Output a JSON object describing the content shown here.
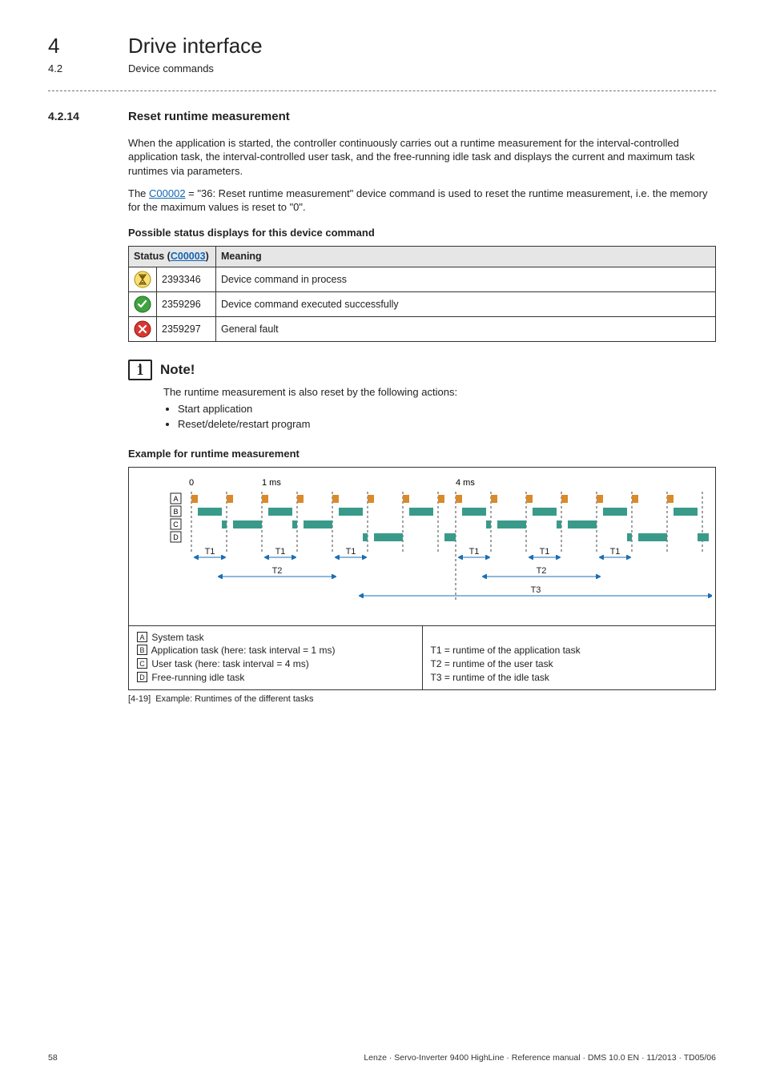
{
  "header": {
    "chapter_num": "4",
    "chapter_title": "Drive interface",
    "sub_num": "4.2",
    "sub_title": "Device commands"
  },
  "section": {
    "num": "4.2.14",
    "title": "Reset runtime measurement"
  },
  "paragraphs": {
    "p1": "When the application is started, the controller continuously carries out a runtime measurement for the interval-controlled application task, the interval-controlled user task, and the free-running idle task and displays the current and maximum task runtimes via parameters.",
    "p2a": "The ",
    "p2_link": "C00002",
    "p2b": " = \"36: Reset runtime measurement\" device command is used to reset the runtime measurement, i.e. the memory for the maximum values is reset to \"0\"."
  },
  "status_heading": "Possible status displays for this device command",
  "status_table": {
    "head_status_label": "Status (",
    "head_status_link": "C00003",
    "head_status_close": ")",
    "head_meaning": "Meaning",
    "rows": [
      {
        "num": "2393346",
        "meaning": "Device command in process"
      },
      {
        "num": "2359296",
        "meaning": "Device command executed successfully"
      },
      {
        "num": "2359297",
        "meaning": "General fault"
      }
    ]
  },
  "note": {
    "title": "Note!",
    "lead": "The runtime measurement is also reset by the following actions:",
    "bullets": [
      "Start application",
      "Reset/delete/restart program"
    ]
  },
  "example_heading": "Example for runtime measurement",
  "diagram": {
    "axis0": "0",
    "axis1ms": "1 ms",
    "axis4ms": "4 ms",
    "labelsABCD": {
      "A": "A",
      "B": "B",
      "C": "C",
      "D": "D"
    },
    "T1": "T1",
    "T2": "T2",
    "T3": "T3",
    "legend_left": {
      "A": " System task",
      "B": " Application task (here: task interval = 1 ms)",
      "C": " User task (here: task interval = 4 ms)",
      "D": " Free-running idle task"
    },
    "legend_right": {
      "l1": "T1 = runtime of the application task",
      "l2": "T2 = runtime of the user task",
      "l3": "T3 = runtime of the idle task"
    }
  },
  "caption": {
    "num": "[4-19]",
    "text": "Example: Runtimes of the different tasks"
  },
  "footer": {
    "page": "58",
    "meta": "Lenze · Servo-Inverter 9400 HighLine · Reference manual · DMS 10.0 EN · 11/2013 · TD05/06"
  }
}
